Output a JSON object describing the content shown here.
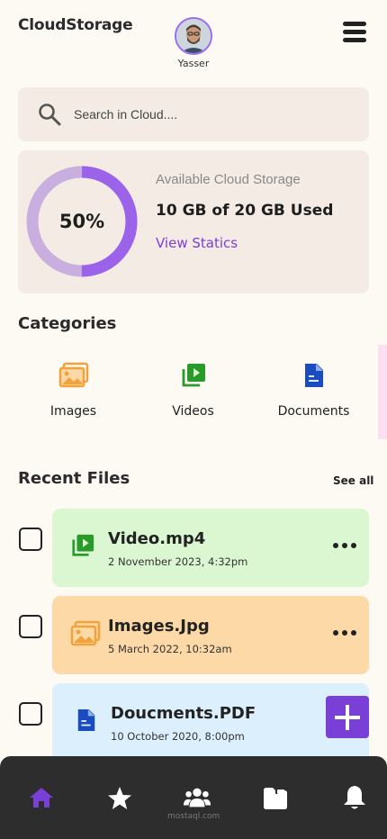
{
  "header": {
    "app_title": "CloudStorage",
    "user_name": "Yasser"
  },
  "search": {
    "placeholder": "Search in Cloud...."
  },
  "storage": {
    "percent_label": "50%",
    "used_fraction": 0.5,
    "title": "Available Cloud Storage",
    "usage": "10 GB of 20 GB Used",
    "link": "View Statics",
    "ring_color": "#9a63ea",
    "track_color": "#c9aee0"
  },
  "categories": {
    "title": "Categories",
    "items": [
      {
        "label": "Images",
        "icon": "images-icon",
        "bg": "#fcd9a6",
        "color": "#f2a23a"
      },
      {
        "label": "Videos",
        "icon": "video-icon",
        "bg": "#daf7d2",
        "color": "#2a9a2a"
      },
      {
        "label": "Documents",
        "icon": "document-icon",
        "bg": "#dbeffc",
        "color": "#1a4bc0"
      }
    ]
  },
  "recent": {
    "title": "Recent Files",
    "see_all": "See all",
    "files": [
      {
        "name": "Video.mp4",
        "date": "2 November 2023, 4:32pm",
        "icon": "video-icon",
        "bg": "#daf7d2"
      },
      {
        "name": "Images.Jpg",
        "date": "5 March 2022, 10:32am",
        "icon": "images-icon",
        "bg": "#fcd9a6"
      },
      {
        "name": "Doucments.PDF",
        "date": "10 October 2020, 8:00pm",
        "icon": "document-icon",
        "bg": "#dbeffc"
      }
    ]
  },
  "nav": {
    "items": [
      "home-icon",
      "star-icon",
      "people-icon",
      "folder-icon",
      "bell-icon"
    ],
    "active_color": "#7a3fd6",
    "watermark": "mostaql.com"
  }
}
